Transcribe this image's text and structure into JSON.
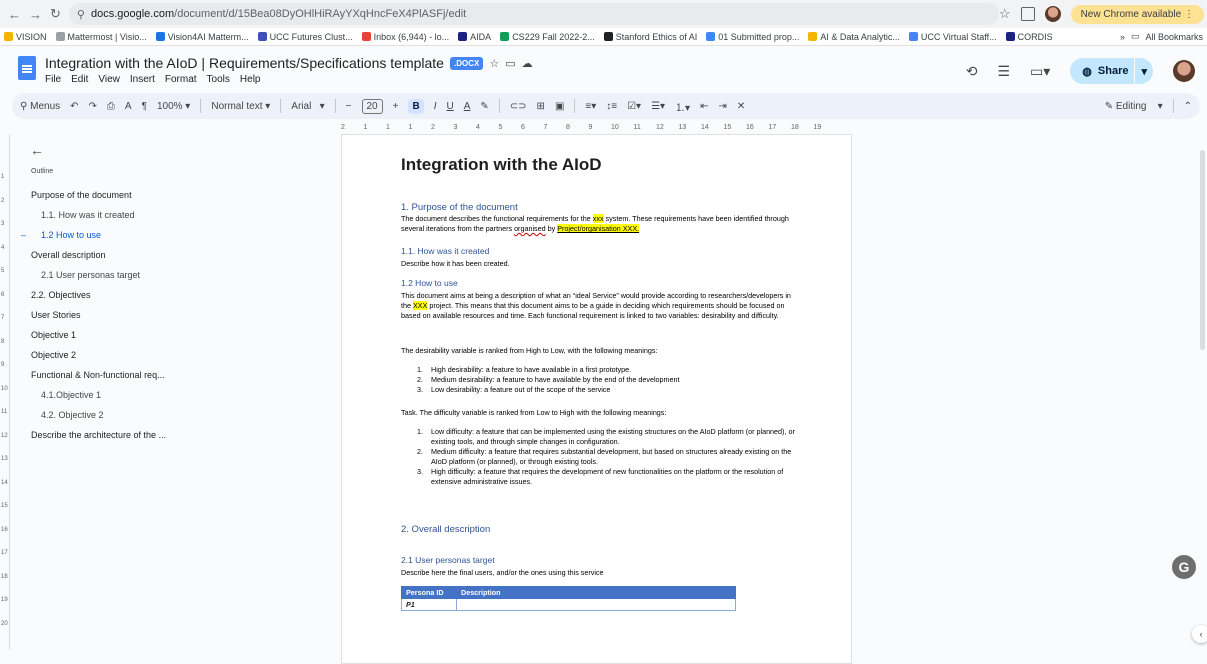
{
  "browser": {
    "url_host": "docs.google.com",
    "url_path": "/document/d/15Bea08DyOHlHiRAyYXqHncFeX4PlASFj/edit",
    "new_chrome_label": "New Chrome available"
  },
  "bookmarks": [
    {
      "label": "VISION",
      "color": "#f4b400"
    },
    {
      "label": "Mattermost | Visio...",
      "color": "#9aa0a6"
    },
    {
      "label": "Vision4AI Matterm...",
      "color": "#1a73e8"
    },
    {
      "label": "UCC Futures Clust...",
      "color": "#3f51b5"
    },
    {
      "label": "Inbox (6,944) - lo...",
      "color": "#ea4335"
    },
    {
      "label": "AIDA",
      "color": "#1a237e"
    },
    {
      "label": "CS229 Fall 2022-2...",
      "color": "#0f9d58"
    },
    {
      "label": "Stanford Ethics of AI",
      "color": "#202124"
    },
    {
      "label": "01 Submitted prop...",
      "color": "#4285f4"
    },
    {
      "label": "AI & Data Analytic...",
      "color": "#f4b400"
    },
    {
      "label": "UCC Virtual Staff...",
      "color": "#4285f4"
    },
    {
      "label": "CORDIS",
      "color": "#1a237e"
    }
  ],
  "bookmarks_overflow": "»",
  "bookmarks_all": "All Bookmarks",
  "docs": {
    "title": "Integration with the AIoD | Requirements/Specifications template",
    "badge": ".DOCX",
    "menus": [
      "File",
      "Edit",
      "View",
      "Insert",
      "Format",
      "Tools",
      "Help"
    ],
    "share_label": "Share"
  },
  "toolbar": {
    "menus_label": "Menus",
    "zoom": "100%",
    "style": "Normal text",
    "font": "Arial",
    "font_size": "20",
    "mode": "Editing"
  },
  "ruler": [
    "2",
    "1",
    "1",
    "1",
    "2",
    "3",
    "4",
    "5",
    "6",
    "7",
    "8",
    "9",
    "10",
    "11",
    "12",
    "13",
    "14",
    "15",
    "16",
    "17",
    "18",
    "19"
  ],
  "ruler_v": [
    "1",
    "2",
    "3",
    "4",
    "5",
    "6",
    "7",
    "8",
    "9",
    "10",
    "11",
    "12",
    "13",
    "14",
    "15",
    "16",
    "17",
    "18",
    "19",
    "20"
  ],
  "outline": {
    "label": "Outline",
    "items": [
      {
        "text": "Purpose of the document",
        "level": 1
      },
      {
        "text": "1.1. How was it created",
        "level": 2
      },
      {
        "text": "1.2 How to use",
        "level": 2,
        "active": true
      },
      {
        "text": "Overall description",
        "level": 1
      },
      {
        "text": "2.1 User personas target",
        "level": 2
      },
      {
        "text": "2.2. Objectives",
        "level": 1
      },
      {
        "text": "User Stories",
        "level": 1
      },
      {
        "text": "Objective 1",
        "level": 1
      },
      {
        "text": "Objective 2",
        "level": 1
      },
      {
        "text": "Functional & Non-functional req...",
        "level": 1
      },
      {
        "text": "4.1.Objective 1",
        "level": 2
      },
      {
        "text": "4.2. Objective 2",
        "level": 2
      },
      {
        "text": "Describe the architecture of the ...",
        "level": 1
      }
    ]
  },
  "document": {
    "h1": "Integration with the AIoD",
    "s1_heading": "1.  Purpose of the document",
    "s1_p_a": "The document describes the functional requirements for the ",
    "s1_p_hl": "xxx",
    "s1_p_b": " system. These requirements have been identified through several iterations from the partners ",
    "s1_p_org": "organised",
    "s1_p_by": " by ",
    "s1_p_proj": "Project/organisation XXX.",
    "s11_heading": "1.1. How was it created",
    "s11_p": "Describe how it has been created.",
    "s12_heading": "1.2 How to use",
    "s12_p_a": "This document aims at being a description of what an “ideal Service” would provide according to researchers/developers in the ",
    "s12_p_hl": "XXX",
    "s12_p_b": " project. This means that this document aims to be a guide in deciding which requirements should be focused on based on available resources and time. Each functional requirement is linked to two variables: desirability and difficulty.",
    "desir_intro": "The desirability variable is ranked from High to Low, with the following meanings:",
    "desir_list": [
      "High desirability: a feature to have available in a first prototype.",
      "Medium desirability: a feature to have available by the end of the development",
      "Low desirability: a feature out of the scope of the service"
    ],
    "diff_intro": "Task. The difficulty variable is ranked from Low to High with the following meanings:",
    "diff_list": [
      "Low difficulty: a feature that can be implemented using the existing structures on the AIoD platform (or planned), or existing tools, and through simple changes in configuration.",
      "Medium difficulty: a feature that requires substantial development, but based on structures already existing on the AIoD platform (or planned), or through existing tools.",
      "High difficulty: a feature that requires the development of new functionalities on the platform or the resolution of extensive administrative issues."
    ],
    "s2_heading": "2.  Overall description",
    "s21_heading": "2.1 User personas target",
    "s21_p": "Describe here the final users, and/or the ones using this service",
    "table_headers": [
      "Persona ID",
      "Description"
    ],
    "table_rows": [
      [
        "P1",
        ""
      ]
    ]
  }
}
